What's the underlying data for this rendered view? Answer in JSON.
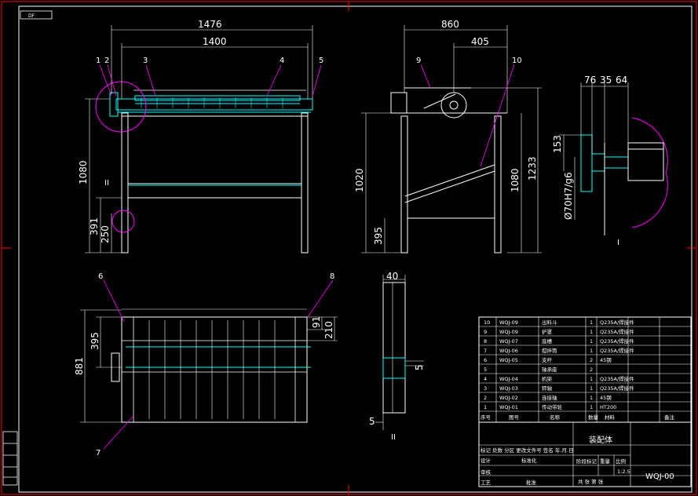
{
  "colors": {
    "background": "#000000",
    "border": "#ff0000",
    "frame": "#ffffff",
    "accent": "#00ffff",
    "leader": "#ff00ff",
    "text": "#ffffff",
    "dimension": "#ffffff"
  },
  "corner_tag": "DF",
  "front_view": {
    "dims": {
      "overall_width": "1476",
      "inner_width": "1400",
      "height": "1080",
      "leg_height": "391",
      "foot_height": "250"
    },
    "part_labels": [
      "1",
      "2",
      "3",
      "4",
      "5"
    ],
    "detail_mark": "II"
  },
  "side_view": {
    "dims": {
      "overall_width": "860",
      "half_width": "405",
      "height_left": "1020",
      "height_mid": "1080",
      "height_right": "1233",
      "bottom": "395"
    },
    "part_labels": [
      "9",
      "10"
    ]
  },
  "detail_view": {
    "dims": {
      "d1": "76",
      "d2": "35",
      "d3": "64",
      "height": "153",
      "fit": "Ø70H7/g6"
    },
    "section_mark": "I"
  },
  "plan_view": {
    "dims": {
      "height": "881",
      "inner_height": "395",
      "right_top": "91",
      "right_mid": "210"
    },
    "part_labels": [
      "6",
      "7",
      "8"
    ]
  },
  "section_view": {
    "dims": {
      "width": "40",
      "gap": "5",
      "bottom": "5"
    },
    "section_mark": "II"
  },
  "bom": {
    "rows": [
      {
        "no": "10",
        "code": "WQJ-09",
        "name": "出料斗",
        "qty": "1",
        "material": "Q235A/焊接件"
      },
      {
        "no": "9",
        "code": "WQJ-09",
        "name": "护罩",
        "qty": "1",
        "material": "Q235A/焊接件"
      },
      {
        "no": "8",
        "code": "WQJ-07",
        "name": "底槽",
        "qty": "1",
        "material": "Q235A/焊接件"
      },
      {
        "no": "7",
        "code": "WQJ-06",
        "name": "搅拌筒",
        "qty": "1",
        "material": "Q235A/焊接件"
      },
      {
        "no": "6",
        "code": "WQJ-05",
        "name": "支杆",
        "qty": "2",
        "material": "45钢"
      },
      {
        "no": "5",
        "code": "",
        "name": "轴承座",
        "qty": "2",
        "material": ""
      },
      {
        "no": "4",
        "code": "WQJ-04",
        "name": "机架",
        "qty": "1",
        "material": "Q235A/焊接件"
      },
      {
        "no": "3",
        "code": "WQJ-03",
        "name": "转轴",
        "qty": "1",
        "material": "Q235A/焊接件"
      },
      {
        "no": "2",
        "code": "WQJ-02",
        "name": "连接轴",
        "qty": "1",
        "material": "45钢"
      },
      {
        "no": "1",
        "code": "WQJ-01",
        "name": "传动带轮",
        "qty": "1",
        "material": "HT200"
      }
    ],
    "headers": {
      "no": "序号",
      "code": "图号",
      "name": "名称",
      "qty": "数量",
      "material": "材料",
      "note": "备注"
    }
  },
  "title_block": {
    "title": "装配体",
    "drawing_no": "WQJ-00",
    "scale": "1:2.5",
    "row_a": "标记 处数  分区  更改文件号  签名  年.月.日",
    "design": "设计",
    "standard": "标准化",
    "stage": "阶段标记",
    "weight": "重量",
    "ratio": "比例",
    "check": "审核",
    "process": "工艺",
    "approve": "批准",
    "sheets": "共  张 第  张"
  }
}
